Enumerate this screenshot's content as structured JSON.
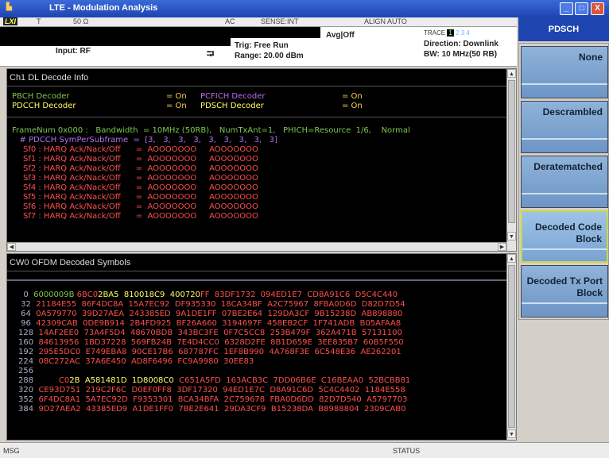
{
  "window": {
    "title": "LTE - Modulation Analysis",
    "min": "_",
    "max": "□",
    "close": "X"
  },
  "status_row": {
    "lxi": "LXI",
    "t": "T",
    "impedance": "50 Ω",
    "coupling": "AC",
    "sense": "SENSE:INT",
    "align": "ALIGN AUTO"
  },
  "info": {
    "input": "Input: RF",
    "avg": "Avg|Off",
    "trig": "Trig: Free Run",
    "range": "Range: 20.00 dBm",
    "trace_label": "TRACE",
    "trace_nums": [
      "1",
      "2",
      "3",
      "4"
    ],
    "direction": "Direction: Downlink",
    "bw": "BW: 10 MHz(50 RB)"
  },
  "menu": {
    "title": "PDSCH",
    "keys": [
      "None",
      "Descrambled",
      "Deratematched",
      "Decoded Code Block",
      "Decoded Tx Port Block"
    ]
  },
  "panel1": {
    "title": "Ch1 DL Decode Info",
    "dec": [
      {
        "a": "PBCH Decoder",
        "b": "= On",
        "c": "PCFICH Decoder",
        "d": "= On"
      },
      {
        "a": "PDCCH Decoder",
        "b": "= On",
        "c": "PDSCH Decoder",
        "d": "= On"
      }
    ],
    "frame": "FrameNum 0x000 :   Bandwidth  = 10MHz (50RB),   NumTxAnt=1,   PHICH=Resource  1/6,    Normal",
    "sym": "   # PDCCH SymPerSubframe  =  [3,   3,   3,   3,   3,   3,   3,   3,   3]",
    "harq": [
      "Sf0 : HARQ Ack/Nack/Off      =  AOOOOOOO     AOOOOOOO",
      "Sf1 : HARQ Ack/Nack/Off      =  AOOOOOOO     AOOOOOOO",
      "Sf2 : HARQ Ack/Nack/Off      =  AOOOOOOO     AOOOOOOO",
      "Sf3 : HARQ Ack/Nack/Off      =  AOOOOOOO     AOOOOOOO",
      "Sf4 : HARQ Ack/Nack/Off      =  AOOOOOOO     AOOOOOOO",
      "Sf5 : HARQ Ack/Nack/Off      =  AOOOOOOO     AOOOOOOO",
      "Sf6 : HARQ Ack/Nack/Off      =  AOOOOOOO     AOOOOOOO",
      "Sf7 : HARQ Ack/Nack/Off      =  AOOOOOOO     AOOOOOOO"
    ]
  },
  "panel2": {
    "title": "CW0 OFDM Decoded Symbols",
    "rows": [
      {
        "n": "  0",
        "s": [
          [
            "6000009B ",
            "#7ec850"
          ],
          [
            "6BC0",
            "#ff4d4d"
          ],
          [
            "2BA5  ",
            "#ffff66"
          ],
          [
            "810018C9  ",
            "#ffff66"
          ],
          [
            "400720",
            "#ffff66"
          ],
          [
            "FF  83DF1732  094ED1E7  CD8A91C6  D5C4C440",
            "#ff4d4d"
          ]
        ]
      },
      {
        "n": " 32",
        "s": [
          [
            "21184E55  86F4DC8A  15A7EC92  DF935330  18CA34BF  A2C75967  8FBA0D6D  D82D7D54",
            "#ff4d4d"
          ]
        ]
      },
      {
        "n": " 64",
        "s": [
          [
            "0A579770  39D27AEA  243385ED  9A1DE1FF  07BE2E64  129DA3CF  9B15238D  AB898880",
            "#ff4d4d"
          ]
        ]
      },
      {
        "n": " 96",
        "s": [
          [
            "42309CAB  0DE9B914  2B4FD925  BF26A660  3194697F  458EB2CF  1F741ADB  B05AFAA8",
            "#ff4d4d"
          ]
        ]
      },
      {
        "n": "128",
        "s": [
          [
            "14AF2EE0  73A4F5D4  48670BDB  343BC3FE  0F7C5CC8  253B479F  362A471B  57131100",
            "#ff4d4d"
          ]
        ]
      },
      {
        "n": "160",
        "s": [
          [
            "84613956  1BD37228  569FB24B  7E4D4CC0  6328D2FE  8B1D659E  3EE835B7  60B5F550",
            "#ff4d4d"
          ]
        ]
      },
      {
        "n": "192",
        "s": [
          [
            "295E5DC0  E749EBA8  90CE17B6  687787FC  1EF8B990  4A768F3E  6C548E36  AE262201",
            "#ff4d4d"
          ]
        ]
      },
      {
        "n": "224",
        "s": [
          [
            "08C272AC  37A6E450  AD8F6496  FC9A9980  30EE83",
            "#ff4d4d"
          ]
        ]
      },
      {
        "n": "256",
        "s": []
      },
      {
        "n": "288",
        "s": [
          [
            "        C0",
            "#ff4d4d"
          ],
          [
            "2B  ",
            "#ffff66"
          ],
          [
            "A581481D  ",
            "#ffff66"
          ],
          [
            "1D8008C0  ",
            "#ffff66"
          ],
          [
            "C651A5FD  163ACB3C  7DD06B6E  C16BEAA0  52BCBB81",
            "#ff4d4d"
          ]
        ]
      },
      {
        "n": "320",
        "s": [
          [
            "CE93D751  219C2F6C  D0EF0FF8  3DF17320  94ED1E7C  D8A91C6D  5C4C4402  1184E558",
            "#ff4d4d"
          ]
        ]
      },
      {
        "n": "352",
        "s": [
          [
            "6F4DC8A1  5A7EC92D  F9353301  8CA34BFA  2C759678  FBA0D6DD  82D7D540  A5797703",
            "#ff4d4d"
          ]
        ]
      },
      {
        "n": "384",
        "s": [
          [
            "9D27AEA2  43385ED9  A1DE1FF0  7BE2E641  29DA3CF9  B15238DA  B8988804  2309CAB0",
            "#ff4d4d"
          ]
        ]
      }
    ]
  },
  "bottom": {
    "msg": "MSG",
    "status": "STATUS"
  }
}
